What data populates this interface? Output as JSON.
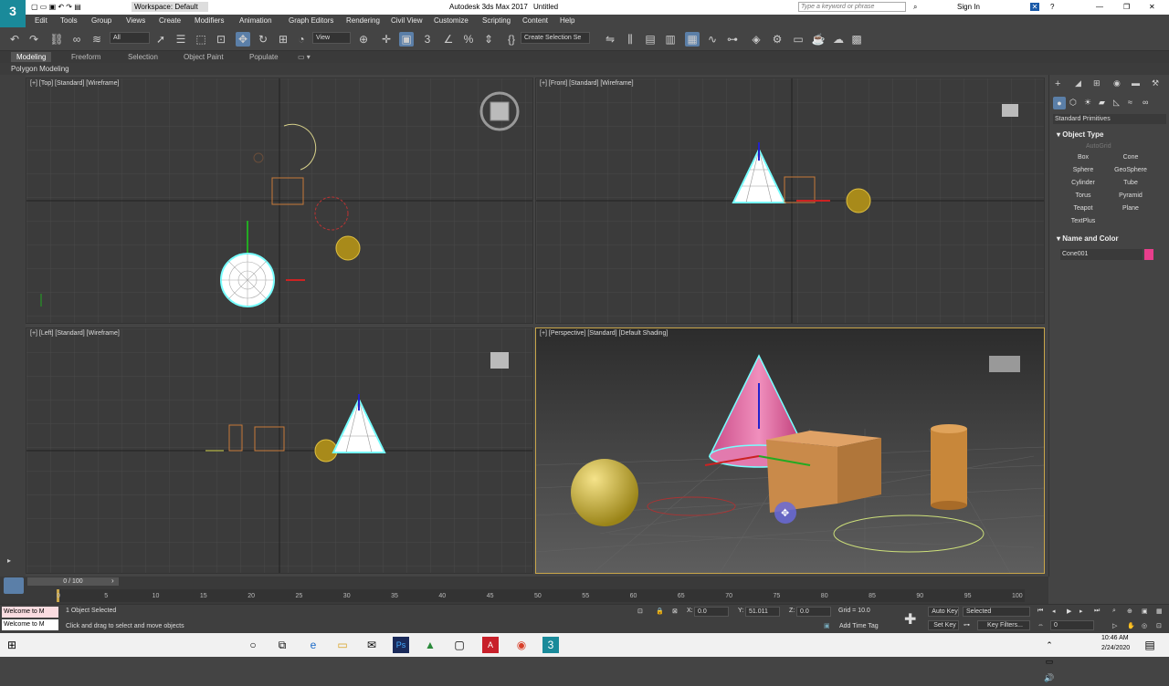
{
  "window": {
    "app_title": "Autodesk 3ds Max 2017",
    "file_title": "Untitled",
    "workspace": "Workspace: Default",
    "search_placeholder": "Type a keyword or phrase",
    "sign_in": "Sign In"
  },
  "menu": [
    "Edit",
    "Tools",
    "Group",
    "Views",
    "Create",
    "Modifiers",
    "Animation",
    "Graph Editors",
    "Rendering",
    "Civil View",
    "Customize",
    "Scripting",
    "Content",
    "Help"
  ],
  "toolbar": {
    "filter": "All",
    "ref_coord": "View",
    "selection_set": "Create Selection Se"
  },
  "ribbon": {
    "tabs": [
      "Modeling",
      "Freeform",
      "Selection",
      "Object Paint",
      "Populate"
    ],
    "sub_label": "Polygon Modeling"
  },
  "viewports": {
    "top": "[+] [Top] [Standard] [Wireframe]",
    "front": "[+] [Front] [Standard] [Wireframe]",
    "left": "[+] [Left] [Standard] [Wireframe]",
    "persp": "[+] [Perspective] [Standard] [Default Shading]"
  },
  "command_panel": {
    "category": "Standard Primitives",
    "object_type_title": "Object Type",
    "autogrid": "AutoGrid",
    "buttons": [
      "Box",
      "Cone",
      "Sphere",
      "GeoSphere",
      "Cylinder",
      "Tube",
      "Torus",
      "Pyramid",
      "Teapot",
      "Plane",
      "TextPlus"
    ],
    "name_color_title": "Name and Color",
    "object_name": "Cone001",
    "object_color": "#e83e8c"
  },
  "timeline": {
    "frame_display": "0 / 100",
    "ticks": [
      "0",
      "5",
      "10",
      "15",
      "20",
      "25",
      "30",
      "35",
      "40",
      "45",
      "50",
      "55",
      "60",
      "65",
      "70",
      "75",
      "80",
      "85",
      "90",
      "95",
      "100"
    ]
  },
  "status": {
    "maxscript": "Welcome to M",
    "selection": "1 Object Selected",
    "prompt": "Click and drag to select and move objects",
    "x_label": "X:",
    "x_value": "0.0",
    "y_label": "Y:",
    "y_value": "51.011",
    "z_label": "Z:",
    "z_value": "0.0",
    "grid": "Grid = 10.0",
    "add_time_tag": "Add Time Tag",
    "auto_key": "Auto Key",
    "set_key": "Set Key",
    "selected": "Selected",
    "key_filters": "Key Filters...",
    "frame": "0"
  },
  "taskbar": {
    "time": "10:46 AM",
    "date": "2/24/2020"
  },
  "colors": {
    "accent": "#5b7fa8",
    "active_viewport_border": "#c9a64a",
    "selection_cyan": "#7ff"
  }
}
